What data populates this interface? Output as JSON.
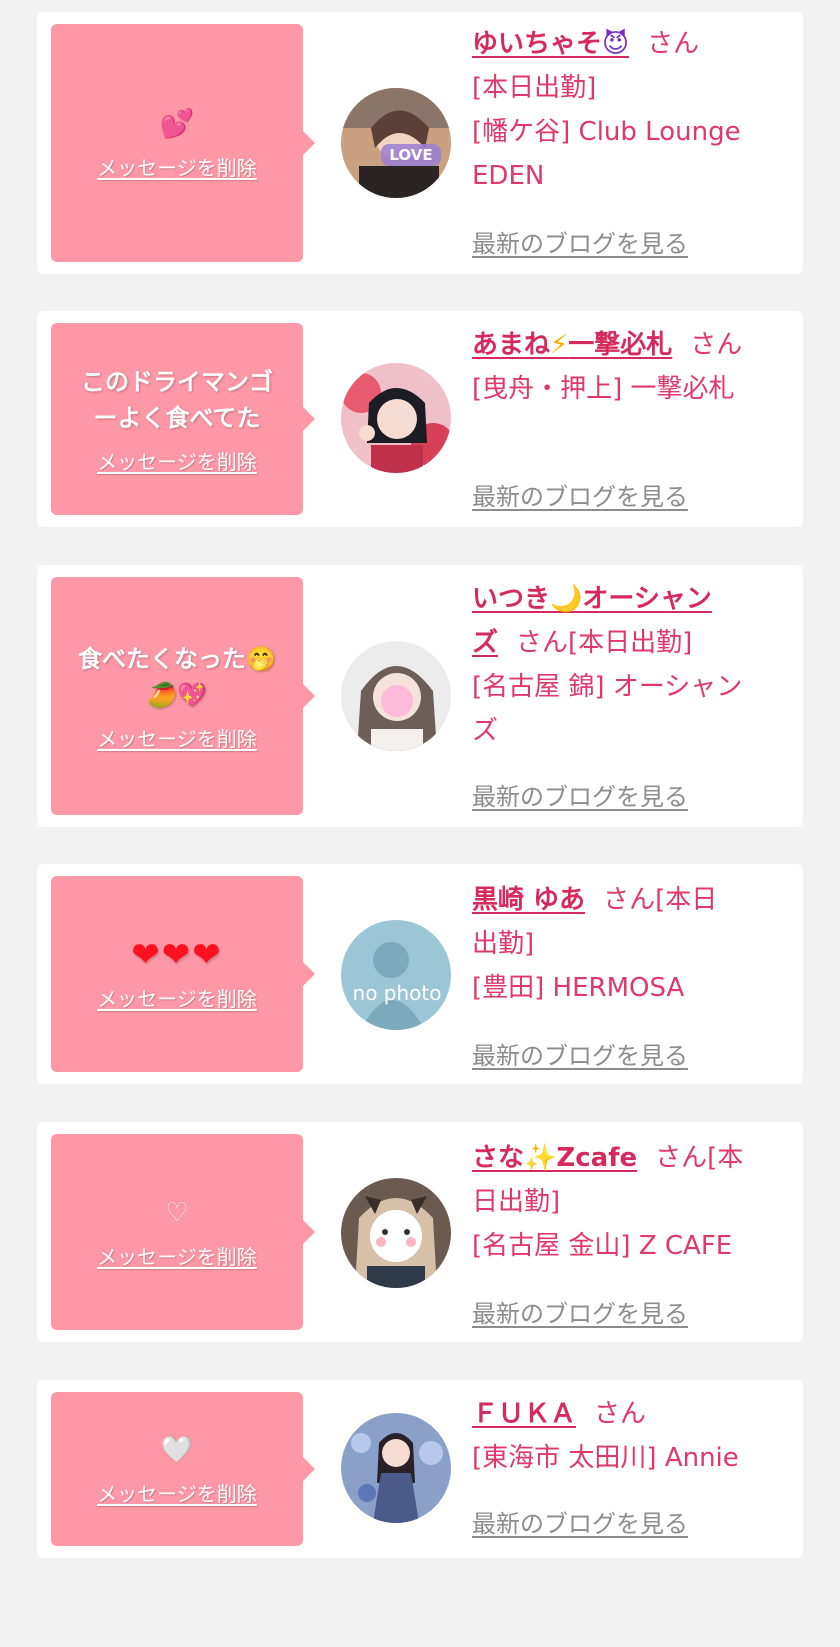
{
  "labels": {
    "delete": "メッセージを削除",
    "blog": "最新のブログを見る",
    "san": "さん"
  },
  "cards": [
    {
      "message": "💕",
      "name_main": "ゆいちゃそ",
      "name_emoji": "😈",
      "detail_lines": [
        "[本日出勤]",
        "[幡ケ谷] Club Lounge",
        "EDEN"
      ],
      "avatar_text": "LOVE"
    },
    {
      "message_lines": [
        "このドライマンゴ",
        "ーよく食べてた"
      ],
      "name_main": "あまね",
      "name_emoji": "⚡",
      "name_tail": "一撃必札",
      "detail_lines": [
        "[曳舟・押上] 一撃必札"
      ]
    },
    {
      "message_lines": [
        "食べたくなった🤭",
        "🥭💖"
      ],
      "name_main": "いつき",
      "name_emoji": "🌙",
      "name_tail": "オーシャン",
      "name_line2": "ズ",
      "san_tail": "[本日出勤]",
      "detail_lines": [
        "[名古屋 錦] オーシャン",
        "ズ"
      ]
    },
    {
      "message": "❤❤❤",
      "name_main": "黒崎 ゆあ",
      "san_tail": "[本日",
      "detail_lines": [
        "出勤]",
        "[豊田] HERMOSA"
      ],
      "avatar_text": "no photo"
    },
    {
      "message": "♡",
      "name_main": "さな",
      "name_emoji": "✨",
      "name_tail": "Zcafe",
      "san_tail": "[本",
      "detail_lines": [
        "日出勤]",
        "[名古屋 金山] Z CAFE"
      ]
    },
    {
      "message": "🤍",
      "name_main": "ＦＵＫＡ",
      "detail_lines": [
        "[東海市 太田川] Annie"
      ]
    }
  ]
}
